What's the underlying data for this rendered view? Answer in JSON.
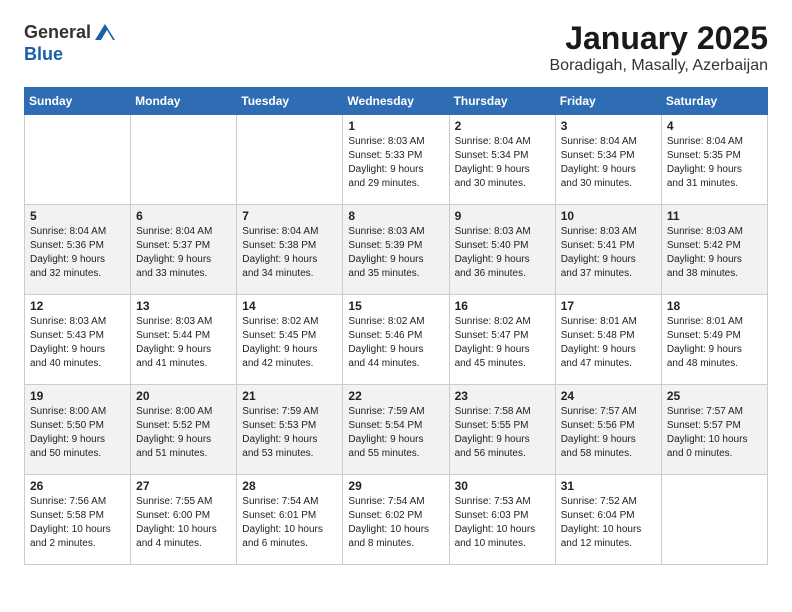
{
  "header": {
    "logo_general": "General",
    "logo_blue": "Blue",
    "title": "January 2025",
    "subtitle": "Boradigah, Masally, Azerbaijan"
  },
  "days_of_week": [
    "Sunday",
    "Monday",
    "Tuesday",
    "Wednesday",
    "Thursday",
    "Friday",
    "Saturday"
  ],
  "weeks": [
    [
      {
        "day": "",
        "info": ""
      },
      {
        "day": "",
        "info": ""
      },
      {
        "day": "",
        "info": ""
      },
      {
        "day": "1",
        "info": "Sunrise: 8:03 AM\nSunset: 5:33 PM\nDaylight: 9 hours\nand 29 minutes."
      },
      {
        "day": "2",
        "info": "Sunrise: 8:04 AM\nSunset: 5:34 PM\nDaylight: 9 hours\nand 30 minutes."
      },
      {
        "day": "3",
        "info": "Sunrise: 8:04 AM\nSunset: 5:34 PM\nDaylight: 9 hours\nand 30 minutes."
      },
      {
        "day": "4",
        "info": "Sunrise: 8:04 AM\nSunset: 5:35 PM\nDaylight: 9 hours\nand 31 minutes."
      }
    ],
    [
      {
        "day": "5",
        "info": "Sunrise: 8:04 AM\nSunset: 5:36 PM\nDaylight: 9 hours\nand 32 minutes."
      },
      {
        "day": "6",
        "info": "Sunrise: 8:04 AM\nSunset: 5:37 PM\nDaylight: 9 hours\nand 33 minutes."
      },
      {
        "day": "7",
        "info": "Sunrise: 8:04 AM\nSunset: 5:38 PM\nDaylight: 9 hours\nand 34 minutes."
      },
      {
        "day": "8",
        "info": "Sunrise: 8:03 AM\nSunset: 5:39 PM\nDaylight: 9 hours\nand 35 minutes."
      },
      {
        "day": "9",
        "info": "Sunrise: 8:03 AM\nSunset: 5:40 PM\nDaylight: 9 hours\nand 36 minutes."
      },
      {
        "day": "10",
        "info": "Sunrise: 8:03 AM\nSunset: 5:41 PM\nDaylight: 9 hours\nand 37 minutes."
      },
      {
        "day": "11",
        "info": "Sunrise: 8:03 AM\nSunset: 5:42 PM\nDaylight: 9 hours\nand 38 minutes."
      }
    ],
    [
      {
        "day": "12",
        "info": "Sunrise: 8:03 AM\nSunset: 5:43 PM\nDaylight: 9 hours\nand 40 minutes."
      },
      {
        "day": "13",
        "info": "Sunrise: 8:03 AM\nSunset: 5:44 PM\nDaylight: 9 hours\nand 41 minutes."
      },
      {
        "day": "14",
        "info": "Sunrise: 8:02 AM\nSunset: 5:45 PM\nDaylight: 9 hours\nand 42 minutes."
      },
      {
        "day": "15",
        "info": "Sunrise: 8:02 AM\nSunset: 5:46 PM\nDaylight: 9 hours\nand 44 minutes."
      },
      {
        "day": "16",
        "info": "Sunrise: 8:02 AM\nSunset: 5:47 PM\nDaylight: 9 hours\nand 45 minutes."
      },
      {
        "day": "17",
        "info": "Sunrise: 8:01 AM\nSunset: 5:48 PM\nDaylight: 9 hours\nand 47 minutes."
      },
      {
        "day": "18",
        "info": "Sunrise: 8:01 AM\nSunset: 5:49 PM\nDaylight: 9 hours\nand 48 minutes."
      }
    ],
    [
      {
        "day": "19",
        "info": "Sunrise: 8:00 AM\nSunset: 5:50 PM\nDaylight: 9 hours\nand 50 minutes."
      },
      {
        "day": "20",
        "info": "Sunrise: 8:00 AM\nSunset: 5:52 PM\nDaylight: 9 hours\nand 51 minutes."
      },
      {
        "day": "21",
        "info": "Sunrise: 7:59 AM\nSunset: 5:53 PM\nDaylight: 9 hours\nand 53 minutes."
      },
      {
        "day": "22",
        "info": "Sunrise: 7:59 AM\nSunset: 5:54 PM\nDaylight: 9 hours\nand 55 minutes."
      },
      {
        "day": "23",
        "info": "Sunrise: 7:58 AM\nSunset: 5:55 PM\nDaylight: 9 hours\nand 56 minutes."
      },
      {
        "day": "24",
        "info": "Sunrise: 7:57 AM\nSunset: 5:56 PM\nDaylight: 9 hours\nand 58 minutes."
      },
      {
        "day": "25",
        "info": "Sunrise: 7:57 AM\nSunset: 5:57 PM\nDaylight: 10 hours\nand 0 minutes."
      }
    ],
    [
      {
        "day": "26",
        "info": "Sunrise: 7:56 AM\nSunset: 5:58 PM\nDaylight: 10 hours\nand 2 minutes."
      },
      {
        "day": "27",
        "info": "Sunrise: 7:55 AM\nSunset: 6:00 PM\nDaylight: 10 hours\nand 4 minutes."
      },
      {
        "day": "28",
        "info": "Sunrise: 7:54 AM\nSunset: 6:01 PM\nDaylight: 10 hours\nand 6 minutes."
      },
      {
        "day": "29",
        "info": "Sunrise: 7:54 AM\nSunset: 6:02 PM\nDaylight: 10 hours\nand 8 minutes."
      },
      {
        "day": "30",
        "info": "Sunrise: 7:53 AM\nSunset: 6:03 PM\nDaylight: 10 hours\nand 10 minutes."
      },
      {
        "day": "31",
        "info": "Sunrise: 7:52 AM\nSunset: 6:04 PM\nDaylight: 10 hours\nand 12 minutes."
      },
      {
        "day": "",
        "info": ""
      }
    ]
  ]
}
